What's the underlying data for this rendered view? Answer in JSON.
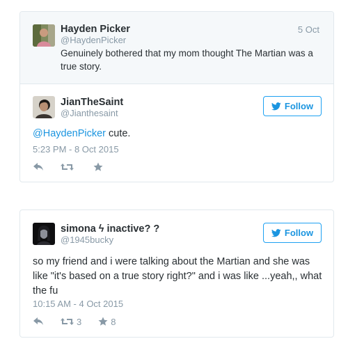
{
  "tweets": [
    {
      "quoted": {
        "name": "Hayden Picker",
        "handle": "@HaydenPicker",
        "date": "5 Oct",
        "text": "Genuinely bothered that my mom thought The Martian was a true story.",
        "avatar_icon": "profile-photo"
      },
      "name": "JianTheSaint",
      "handle": "@Jianthesaint",
      "follow_label": "Follow",
      "mention": "@HaydenPicker",
      "text_rest": " cute.",
      "timestamp": "5:23 PM - 8 Oct 2015",
      "retweets": "",
      "likes": "",
      "avatar_icon": "profile-photo"
    },
    {
      "name": "simona ϟ inactive? ?",
      "handle": "@1945bucky",
      "follow_label": "Follow",
      "text": "so my friend and i were talking about the Martian and she was like \"it's based on a true story right?\"  and i was like ...yeah,, what the fu",
      "timestamp": "10:15 AM - 4 Oct 2015",
      "retweets": "3",
      "likes": "8",
      "avatar_icon": "profile-photo"
    }
  ],
  "colors": {
    "accent": "#1b95e0",
    "muted": "#8899a6",
    "text": "#292f33",
    "border": "#e1e8ed",
    "quoted_bg": "#f5f8fa"
  },
  "icons": [
    "reply-icon",
    "retweet-icon",
    "like-icon",
    "bird-icon"
  ]
}
